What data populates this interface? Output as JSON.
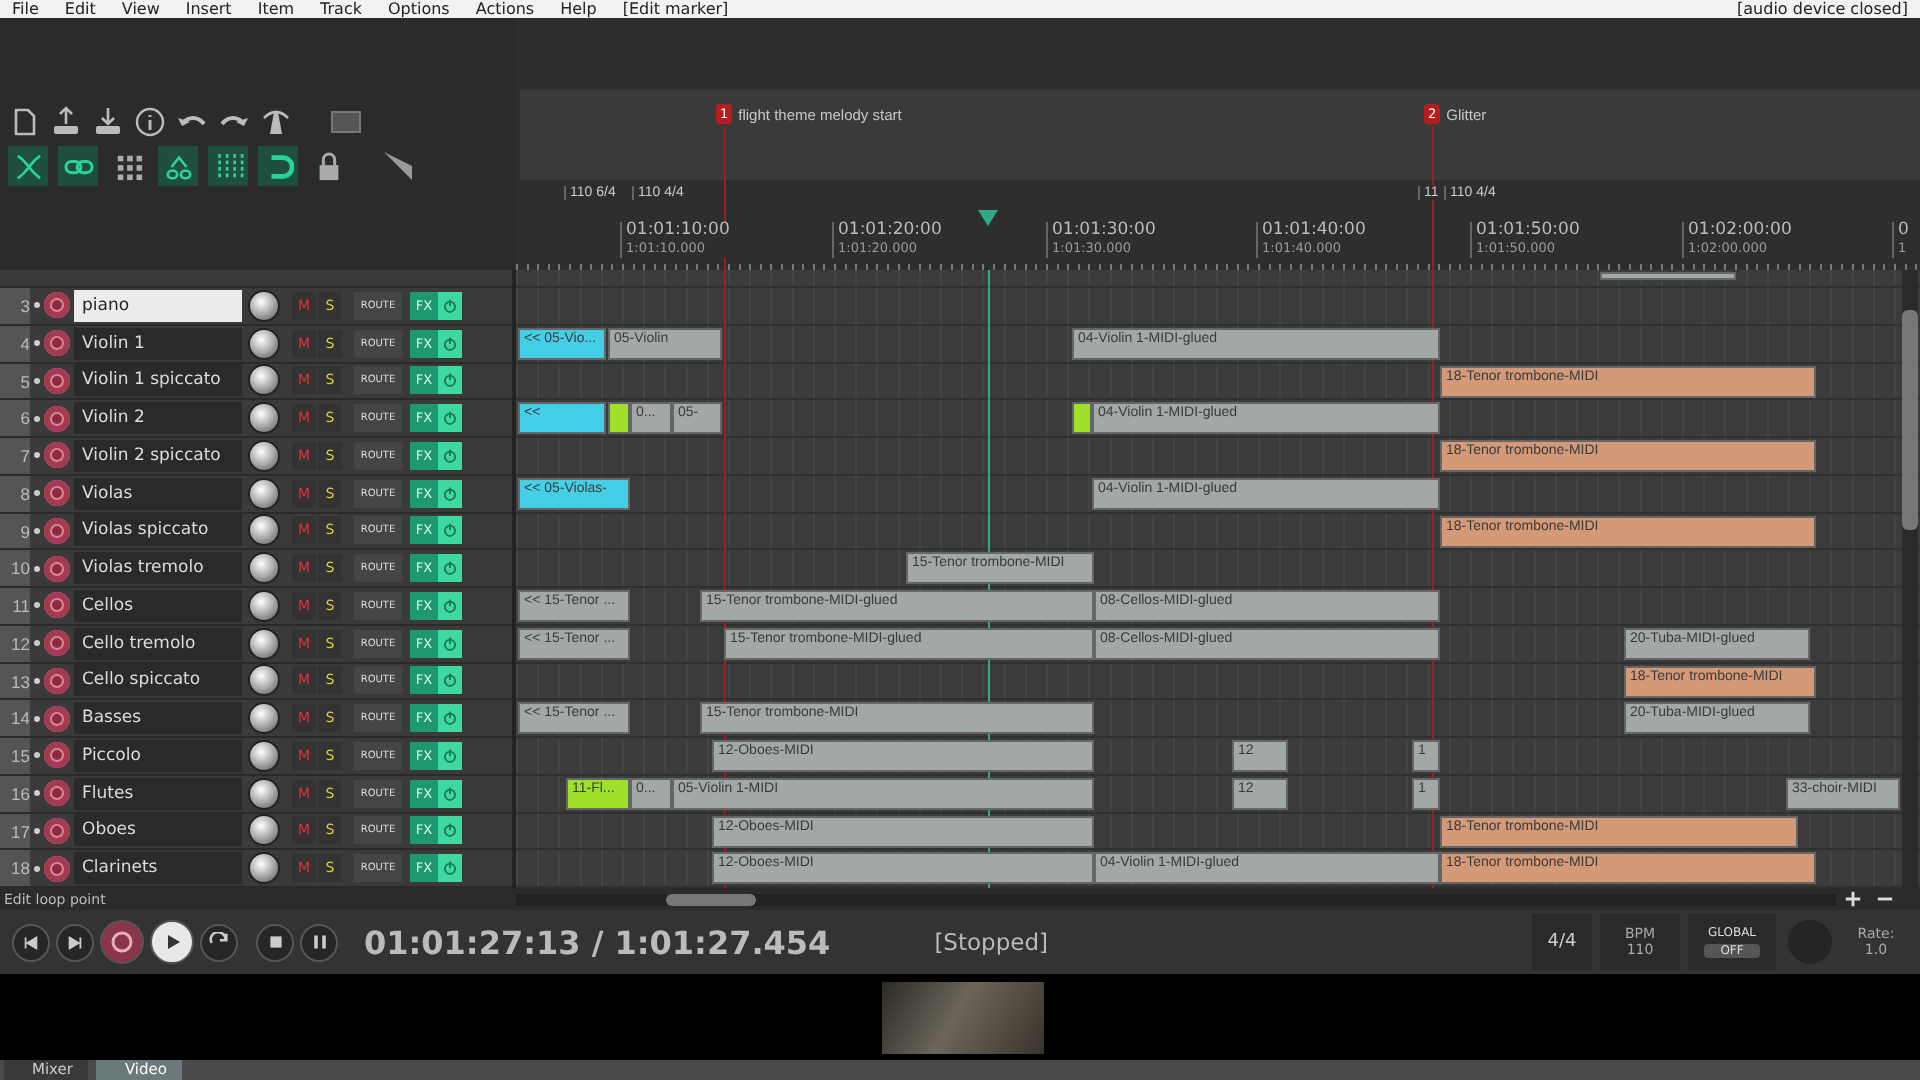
{
  "menu": {
    "items": [
      "File",
      "Edit",
      "View",
      "Insert",
      "Item",
      "Track",
      "Options",
      "Actions",
      "Help",
      "[Edit marker]"
    ],
    "status": "[audio device closed]"
  },
  "toolbar": {
    "toggles": [
      {
        "on": true
      },
      {
        "on": true
      },
      {
        "on": false
      },
      {
        "on": true
      },
      {
        "on": true
      },
      {
        "on": true
      },
      {
        "on": false
      }
    ]
  },
  "ruler": {
    "markers": [
      {
        "number": "1",
        "name": "flight theme melody start"
      },
      {
        "number": "2",
        "name": "Glitter"
      }
    ],
    "tempo_markers": [
      "110 6/4",
      "110 4/4",
      "11",
      "110 4/4"
    ],
    "times": [
      {
        "timecode": "01:01:10:00",
        "seconds": "1:01:10.000"
      },
      {
        "timecode": "01:01:20:00",
        "seconds": "1:01:20.000"
      },
      {
        "timecode": "01:01:30:00",
        "seconds": "1:01:30.000"
      },
      {
        "timecode": "01:01:40:00",
        "seconds": "1:01:40.000"
      },
      {
        "timecode": "01:01:50:00",
        "seconds": "1:01:50.000"
      },
      {
        "timecode": "01:02:00:00",
        "seconds": "1:02:00.000"
      },
      {
        "timecode": "0",
        "seconds": "1"
      }
    ]
  },
  "tracks": [
    {
      "number": "3",
      "name": "piano",
      "selected": true
    },
    {
      "number": "4",
      "name": "Violin 1",
      "selected": false,
      "items": [
        {
          "label": "<< 05-Vio...",
          "color": "#45cfe6"
        },
        {
          "label": "05-Violin",
          "color": "#a2a8a8"
        },
        {
          "label": "04-Violin 1-MIDI-glued",
          "color": "#a2a8a8"
        }
      ]
    },
    {
      "number": "5",
      "name": "Violin 1 spiccato",
      "selected": false,
      "items": [
        {
          "label": "18-Tenor trombone-MIDI",
          "color": "#d49a78"
        }
      ]
    },
    {
      "number": "6",
      "name": "Violin 2",
      "selected": false,
      "items": [
        {
          "label": "<<",
          "color": "#45cfe6"
        },
        {
          "color": "#9fe02a"
        },
        {
          "label": "0...",
          "color": "#a2a8a8"
        },
        {
          "label": "05-",
          "color": "#a2a8a8"
        },
        {
          "color": "#9fe02a"
        },
        {
          "label": "04-Violin 1-MIDI-glued",
          "color": "#a2a8a8"
        }
      ]
    },
    {
      "number": "7",
      "name": "Violin 2 spiccato",
      "selected": false,
      "items": [
        {
          "label": "18-Tenor trombone-MIDI",
          "color": "#d49a78"
        }
      ]
    },
    {
      "number": "8",
      "name": "Violas",
      "selected": false,
      "items": [
        {
          "label": "<< 05-Violas-",
          "color": "#45cfe6"
        },
        {
          "label": "04-Violin 1-MIDI-glued",
          "color": "#a2a8a8"
        }
      ]
    },
    {
      "number": "9",
      "name": "Violas spiccato",
      "selected": false,
      "items": [
        {
          "label": "18-Tenor trombone-MIDI",
          "color": "#d49a78"
        }
      ]
    },
    {
      "number": "10",
      "name": "Violas tremolo",
      "selected": false,
      "items": [
        {
          "label": "15-Tenor trombone-MIDI",
          "color": "#a2a8a8"
        }
      ]
    },
    {
      "number": "11",
      "name": "Cellos",
      "selected": false,
      "items": [
        {
          "label": "<< 15-Tenor ...",
          "color": "#a2a8a8"
        },
        {
          "label": "15-Tenor trombone-MIDI-glued",
          "color": "#a2a8a8"
        },
        {
          "label": "08-Cellos-MIDI-glued",
          "color": "#a2a8a8"
        }
      ]
    },
    {
      "number": "12",
      "name": "Cello tremolo",
      "selected": false,
      "items": [
        {
          "label": "<< 15-Tenor ...",
          "color": "#a2a8a8"
        },
        {
          "label": "15-Tenor trombone-MIDI-glued",
          "color": "#a2a8a8"
        },
        {
          "label": "08-Cellos-MIDI-glued",
          "color": "#a2a8a8"
        },
        {
          "label": "20-Tuba-MIDI-glued",
          "color": "#a2a8a8"
        }
      ]
    },
    {
      "number": "13",
      "name": "Cello spiccato",
      "selected": false,
      "items": [
        {
          "label": "18-Tenor trombone-MIDI",
          "color": "#d49a78"
        }
      ]
    },
    {
      "number": "14",
      "name": "Basses",
      "selected": false,
      "items": [
        {
          "label": "<< 15-Tenor ...",
          "color": "#a2a8a8"
        },
        {
          "label": "15-Tenor trombone-MIDI",
          "color": "#a2a8a8"
        },
        {
          "label": "20-Tuba-MIDI-glued",
          "color": "#a2a8a8"
        }
      ]
    },
    {
      "number": "15",
      "name": "Piccolo",
      "selected": false,
      "items": [
        {
          "label": "12-Oboes-MIDI",
          "color": "#a2a8a8"
        },
        {
          "label": "12",
          "color": "#a2a8a8"
        },
        {
          "label": "1",
          "color": "#a2a8a8"
        }
      ]
    },
    {
      "number": "16",
      "name": "Flutes",
      "selected": false,
      "items": [
        {
          "label": "11-Fl...",
          "color": "#9fe02a"
        },
        {
          "label": "0...",
          "color": "#a2a8a8"
        },
        {
          "label": "05-Violin 1-MIDI",
          "color": "#a2a8a8"
        },
        {
          "label": "12",
          "color": "#a2a8a8"
        },
        {
          "label": "1",
          "color": "#a2a8a8"
        },
        {
          "label": "33-choir-MIDI",
          "color": "#a2a8a8"
        }
      ]
    },
    {
      "number": "17",
      "name": "Oboes",
      "selected": false,
      "items": [
        {
          "label": "12-Oboes-MIDI",
          "color": "#a2a8a8"
        },
        {
          "label": "18-Tenor trombone-MIDI",
          "color": "#d49a78"
        }
      ]
    },
    {
      "number": "18",
      "name": "Clarinets",
      "selected": false,
      "items": [
        {
          "label": "12-Oboes-MIDI",
          "color": "#a2a8a8"
        },
        {
          "label": "04-Violin 1-MIDI-glued",
          "color": "#a2a8a8"
        },
        {
          "label": "18-Tenor trombone-MIDI",
          "color": "#d49a78"
        }
      ]
    }
  ],
  "track_controls": [
    {
      "mute": "M",
      "solo": "S",
      "route": "ROUTE",
      "fx": "FX"
    },
    {
      "mute": "M",
      "solo": "S",
      "route": "ROUTE",
      "fx": "FX"
    },
    {
      "mute": "M",
      "solo": "S",
      "route": "ROUTE",
      "fx": "FX"
    },
    {
      "mute": "M",
      "solo": "S",
      "route": "ROUTE",
      "fx": "FX"
    },
    {
      "mute": "M",
      "solo": "S",
      "route": "ROUTE",
      "fx": "FX"
    },
    {
      "mute": "M",
      "solo": "S",
      "route": "ROUTE",
      "fx": "FX"
    },
    {
      "mute": "M",
      "solo": "S",
      "route": "ROUTE",
      "fx": "FX"
    },
    {
      "mute": "M",
      "solo": "S",
      "route": "ROUTE",
      "fx": "FX"
    },
    {
      "mute": "M",
      "solo": "S",
      "route": "ROUTE",
      "fx": "FX"
    },
    {
      "mute": "M",
      "solo": "S",
      "route": "ROUTE",
      "fx": "FX"
    },
    {
      "mute": "M",
      "solo": "S",
      "route": "ROUTE",
      "fx": "FX"
    },
    {
      "mute": "M",
      "solo": "S",
      "route": "ROUTE",
      "fx": "FX"
    },
    {
      "mute": "M",
      "solo": "S",
      "route": "ROUTE",
      "fx": "FX"
    },
    {
      "mute": "M",
      "solo": "S",
      "route": "ROUTE",
      "fx": "FX"
    },
    {
      "mute": "M",
      "solo": "S",
      "route": "ROUTE",
      "fx": "FX"
    },
    {
      "mute": "M",
      "solo": "S",
      "route": "ROUTE",
      "fx": "FX"
    }
  ],
  "status_line": "Edit loop point",
  "transport": {
    "time": "01:01:27:13 / 1:01:27.454",
    "state": "[Stopped]",
    "time_signature": "4/4",
    "bpm_label": "BPM",
    "bpm": "110",
    "global_label": "GLOBAL",
    "global_value": "OFF",
    "rate_label": "Rate:",
    "rate": "1.0"
  },
  "dock_tabs": [
    {
      "label": "Mixer",
      "selected": false
    },
    {
      "label": "Video",
      "selected": true
    }
  ]
}
